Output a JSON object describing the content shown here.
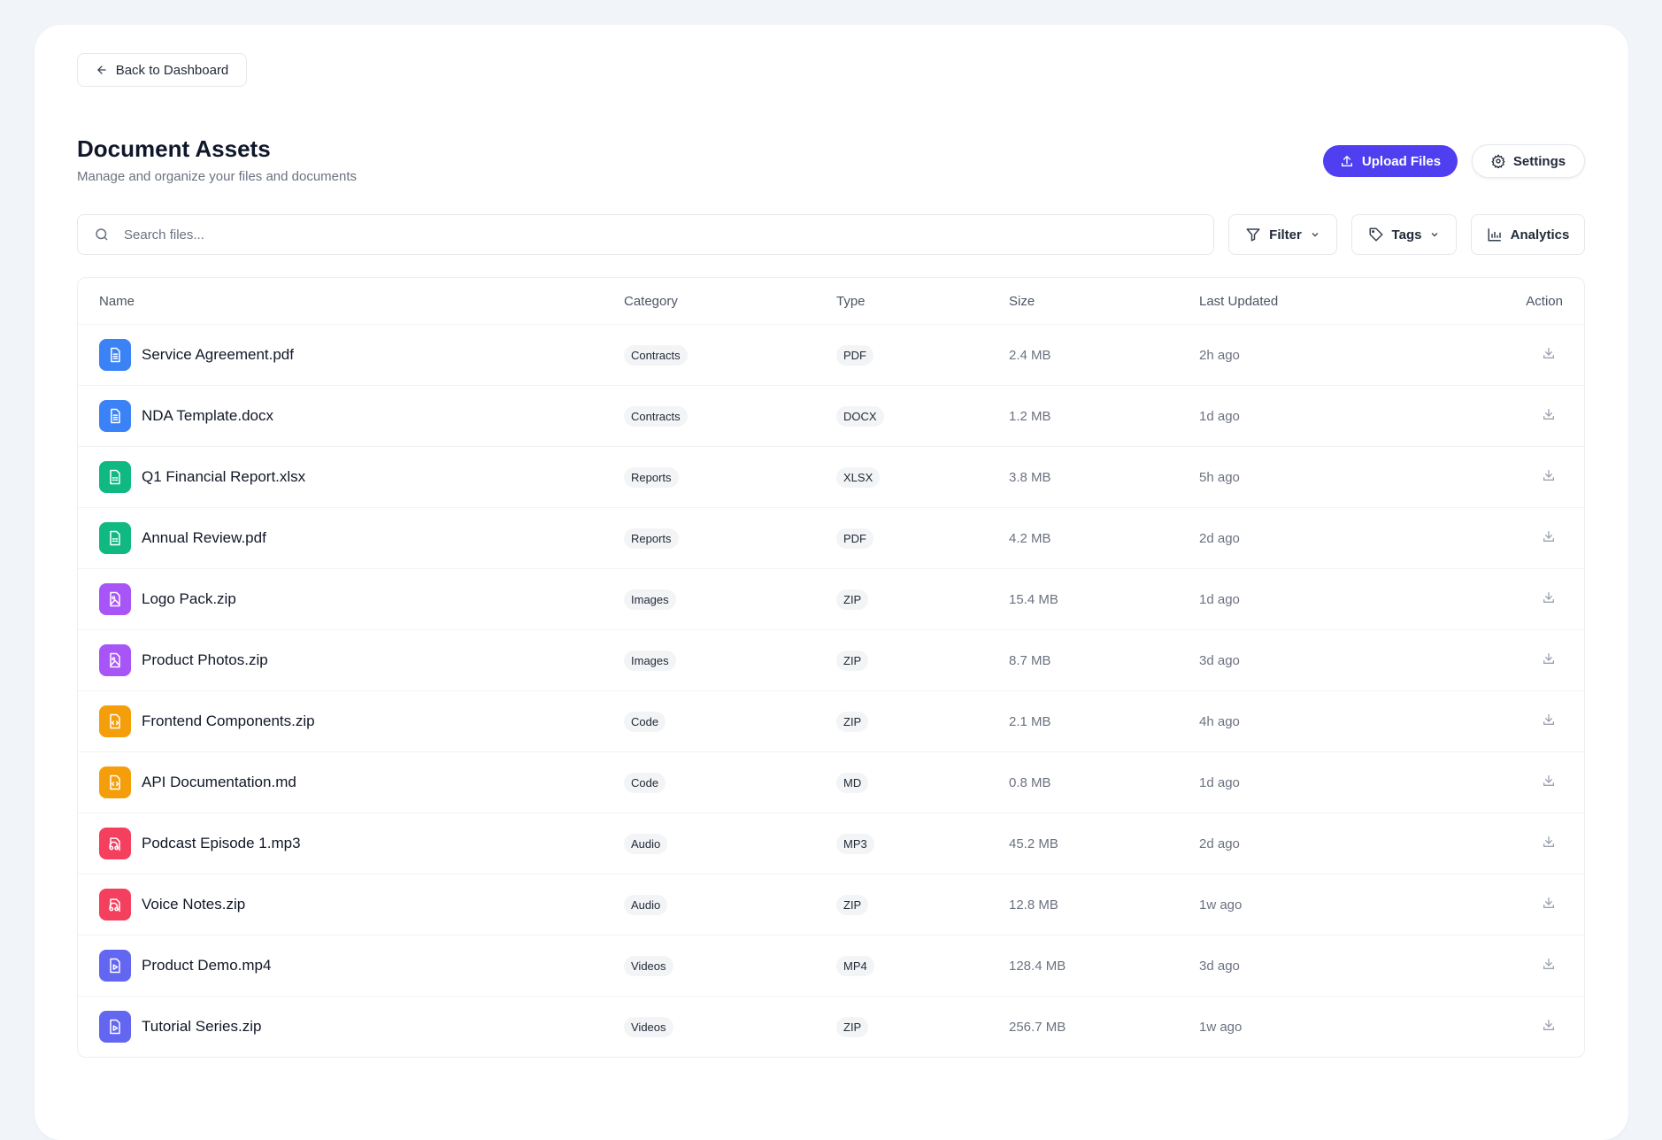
{
  "back_label": "Back to Dashboard",
  "title": "Document Assets",
  "subtitle": "Manage and organize your files and documents",
  "upload_label": "Upload Files",
  "settings_label": "Settings",
  "search_placeholder": "Search files...",
  "filter_label": "Filter",
  "tags_label": "Tags",
  "analytics_label": "Analytics",
  "accent": "#4f3ff0",
  "columns": [
    "Name",
    "Category",
    "Type",
    "Size",
    "Last Updated",
    "Action"
  ],
  "rows": [
    {
      "name": "Service Agreement.pdf",
      "category": "Contracts",
      "type": "PDF",
      "size": "2.4 MB",
      "updated": "2h ago",
      "icon": "document-icon",
      "color": "#3b82f6"
    },
    {
      "name": "NDA Template.docx",
      "category": "Contracts",
      "type": "DOCX",
      "size": "1.2 MB",
      "updated": "1d ago",
      "icon": "document-icon",
      "color": "#3b82f6"
    },
    {
      "name": "Q1 Financial Report.xlsx",
      "category": "Reports",
      "type": "XLSX",
      "size": "3.8 MB",
      "updated": "5h ago",
      "icon": "spreadsheet-icon",
      "color": "#10b981"
    },
    {
      "name": "Annual Review.pdf",
      "category": "Reports",
      "type": "PDF",
      "size": "4.2 MB",
      "updated": "2d ago",
      "icon": "spreadsheet-icon",
      "color": "#10b981"
    },
    {
      "name": "Logo Pack.zip",
      "category": "Images",
      "type": "ZIP",
      "size": "15.4 MB",
      "updated": "1d ago",
      "icon": "image-file-icon",
      "color": "#a855f7"
    },
    {
      "name": "Product Photos.zip",
      "category": "Images",
      "type": "ZIP",
      "size": "8.7 MB",
      "updated": "3d ago",
      "icon": "image-file-icon",
      "color": "#a855f7"
    },
    {
      "name": "Frontend Components.zip",
      "category": "Code",
      "type": "ZIP",
      "size": "2.1 MB",
      "updated": "4h ago",
      "icon": "code-file-icon",
      "color": "#f59e0b"
    },
    {
      "name": "API Documentation.md",
      "category": "Code",
      "type": "MD",
      "size": "0.8 MB",
      "updated": "1d ago",
      "icon": "code-file-icon",
      "color": "#f59e0b"
    },
    {
      "name": "Podcast Episode 1.mp3",
      "category": "Audio",
      "type": "MP3",
      "size": "45.2 MB",
      "updated": "2d ago",
      "icon": "audio-file-icon",
      "color": "#f43f5e"
    },
    {
      "name": "Voice Notes.zip",
      "category": "Audio",
      "type": "ZIP",
      "size": "12.8 MB",
      "updated": "1w ago",
      "icon": "audio-file-icon",
      "color": "#f43f5e"
    },
    {
      "name": "Product Demo.mp4",
      "category": "Videos",
      "type": "MP4",
      "size": "128.4 MB",
      "updated": "3d ago",
      "icon": "video-file-icon",
      "color": "#6366f1"
    },
    {
      "name": "Tutorial Series.zip",
      "category": "Videos",
      "type": "ZIP",
      "size": "256.7 MB",
      "updated": "1w ago",
      "icon": "video-file-icon",
      "color": "#6366f1"
    }
  ]
}
